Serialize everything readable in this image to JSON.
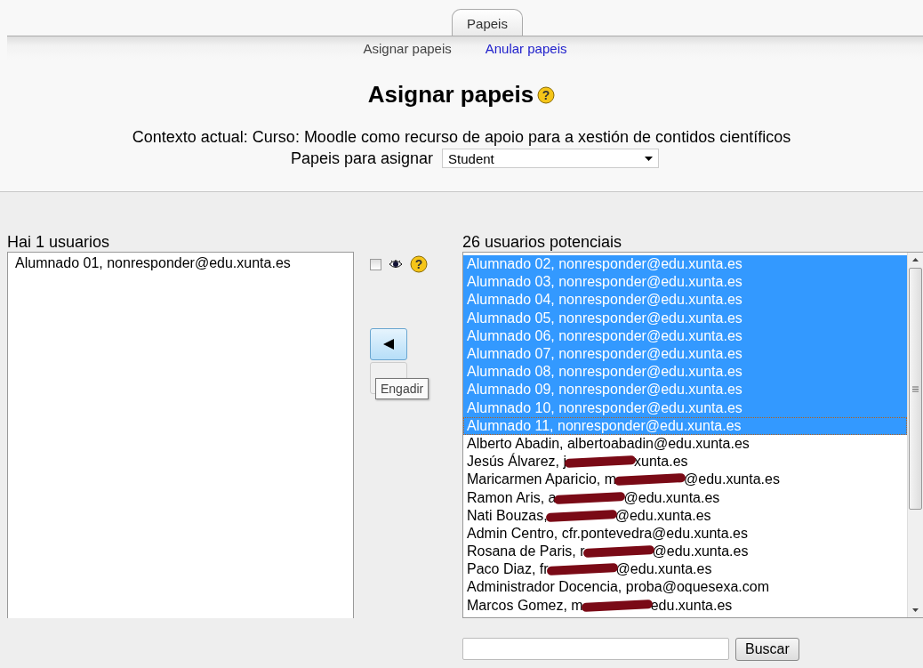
{
  "tabs": [
    {
      "label": "Papeis",
      "selected": true
    }
  ],
  "subtabs": [
    {
      "label": "Asignar papeis",
      "selected": true
    },
    {
      "label": "Anular papeis",
      "selected": false
    }
  ],
  "heading": "Asignar papeis",
  "heading_help": "?",
  "context": "Contexto actual: Curso: Moodle como recurso de apoio para a xestión de contidos científicos",
  "role_select": {
    "label": "Papeis para asignar",
    "value": "Student"
  },
  "existing": {
    "title": "Hai 1 usuarios",
    "options": [
      {
        "text": "Alumnado 01, nonresponder@edu.xunta.es",
        "selected": false
      }
    ]
  },
  "controls": {
    "hidden_checkbox": {
      "checked": false
    },
    "help": "?",
    "tooltip": "Engadir"
  },
  "potential": {
    "title": "26 usuarios potenciais",
    "options": [
      {
        "text": "Alumnado 02, nonresponder@edu.xunta.es",
        "selected": true
      },
      {
        "text": "Alumnado 03, nonresponder@edu.xunta.es",
        "selected": true
      },
      {
        "text": "Alumnado 04, nonresponder@edu.xunta.es",
        "selected": true
      },
      {
        "text": "Alumnado 05, nonresponder@edu.xunta.es",
        "selected": true
      },
      {
        "text": "Alumnado 06, nonresponder@edu.xunta.es",
        "selected": true
      },
      {
        "text": "Alumnado 07, nonresponder@edu.xunta.es",
        "selected": true
      },
      {
        "text": "Alumnado 08, nonresponder@edu.xunta.es",
        "selected": true
      },
      {
        "text": "Alumnado 09, nonresponder@edu.xunta.es",
        "selected": true
      },
      {
        "text": "Alumnado 10, nonresponder@edu.xunta.es",
        "selected": true
      },
      {
        "text": "Alumnado 11, nonresponder@edu.xunta.es",
        "selected": true
      },
      {
        "text": "Alberto Abadin, albertoabadin@edu.xunta.es",
        "selected": false
      },
      {
        "text": "Jesús Álvarez, j",
        "after_redaction": "xunta.es",
        "selected": false
      },
      {
        "text": "Maricarmen Aparicio, m",
        "after_redaction": "@edu.xunta.es",
        "selected": false
      },
      {
        "text": "Ramon Aris, a",
        "after_redaction": "@edu.xunta.es",
        "selected": false
      },
      {
        "text": "Nati Bouzas,",
        "after_redaction": "@edu.xunta.es",
        "selected": false
      },
      {
        "text": "Admin Centro, cfr.pontevedra@edu.xunta.es",
        "selected": false
      },
      {
        "text": "Rosana de Paris, r",
        "after_redaction": "@edu.xunta.es",
        "selected": false
      },
      {
        "text": "Paco Diaz, fr",
        "after_redaction": "@edu.xunta.es",
        "selected": false
      },
      {
        "text": "Administrador Docencia, proba@oquesexa.com",
        "selected": false
      },
      {
        "text": "Marcos Gomez, m",
        "after_redaction": "edu.xunta.es",
        "selected": false
      }
    ]
  },
  "search": {
    "button": "Buscar"
  }
}
